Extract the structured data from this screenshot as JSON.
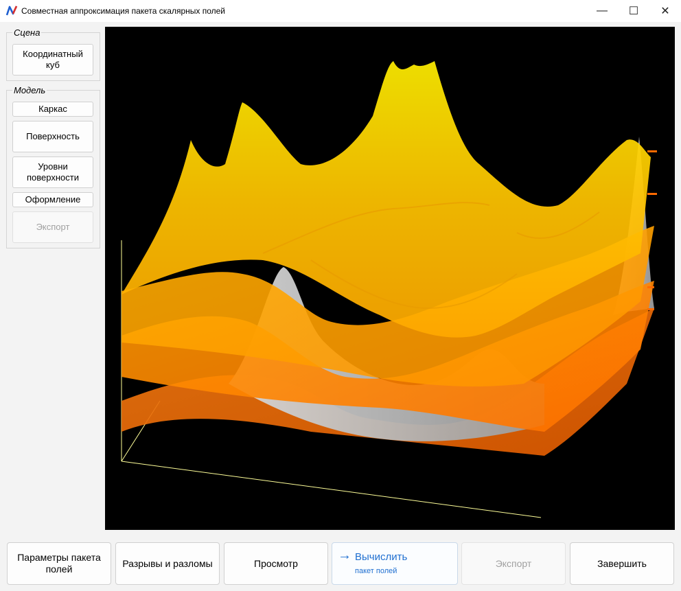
{
  "window": {
    "title": "Совместная аппроксимация пакета скалярных полей",
    "icon": "app-logo-icon",
    "controls": {
      "minimize": "—",
      "maximize": "☐",
      "close": "✕"
    }
  },
  "sidebar": {
    "scene": {
      "label": "Сцена",
      "buttons": [
        {
          "label": "Координатный\nкуб",
          "enabled": true
        }
      ]
    },
    "model": {
      "label": "Модель",
      "buttons": [
        {
          "label": "Каркас",
          "enabled": true
        },
        {
          "label": "Поверхность",
          "enabled": true
        },
        {
          "label": "Уровни\nповерхности",
          "enabled": true
        },
        {
          "label": "Оформление",
          "enabled": true
        },
        {
          "label": "Экспорт",
          "enabled": false
        }
      ]
    }
  },
  "viewport": {
    "background": "#000000",
    "surface_colors": [
      "#ffd000",
      "#ffb300",
      "#ff9500",
      "#ff7a00",
      "#c8c8c8"
    ],
    "axis_color": "#ffff99"
  },
  "bottom_bar": {
    "params": "Параметры пакета\nполей",
    "faults": "Разрывы и разломы",
    "view": "Просмотр",
    "compute": {
      "label": "Вычислить",
      "sub": "пакет полей",
      "icon": "arrow-right-icon"
    },
    "export": "Экспорт",
    "finish": "Завершить"
  }
}
